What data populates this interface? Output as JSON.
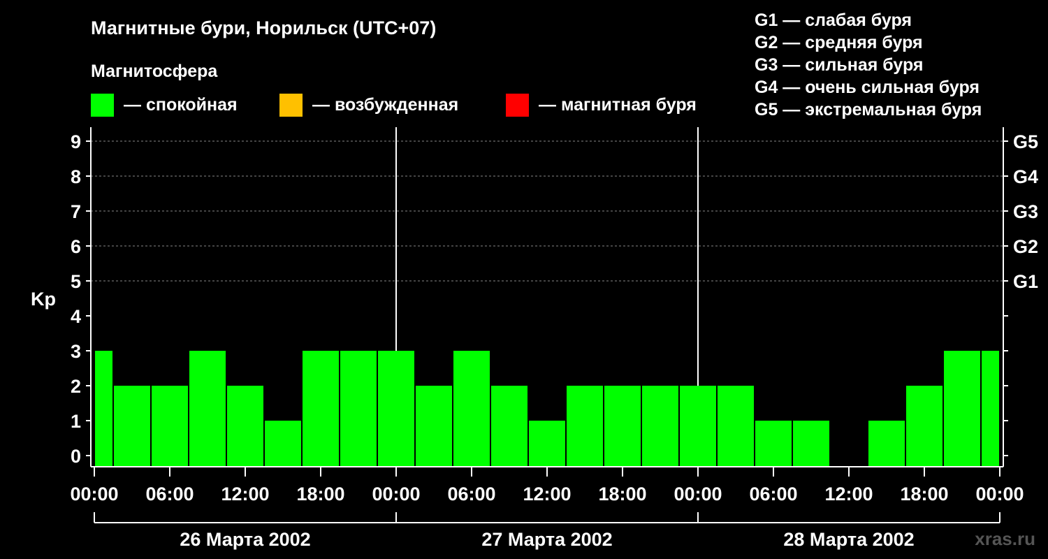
{
  "chart_data": {
    "type": "bar",
    "title": "Магнитные бури, Норильск (UTC+07)",
    "legend_title": "Магнитосфера",
    "legend": [
      {
        "label": "— спокойная",
        "color": "#00ff00"
      },
      {
        "label": "— возбужденная",
        "color": "#ffc000"
      },
      {
        "label": "— магнитная буря",
        "color": "#ff0000"
      }
    ],
    "g_scale_legend": [
      "G1 — слабая буря",
      "G2 — средняя буря",
      "G3 — сильная буря",
      "G4 — очень сильная буря",
      "G5 — экстремальная буря"
    ],
    "ylabel": "Kp",
    "ylim": [
      0,
      9
    ],
    "yticks": [
      "0",
      "1",
      "2",
      "3",
      "4",
      "5",
      "6",
      "7",
      "8",
      "9"
    ],
    "right_ticks": [
      {
        "kp": 5,
        "label": "G1"
      },
      {
        "kp": 6,
        "label": "G2"
      },
      {
        "kp": 7,
        "label": "G3"
      },
      {
        "kp": 8,
        "label": "G4"
      },
      {
        "kp": 9,
        "label": "G5"
      }
    ],
    "x_ticks": [
      "00:00",
      "06:00",
      "12:00",
      "18:00",
      "00:00",
      "06:00",
      "12:00",
      "18:00",
      "00:00",
      "06:00",
      "12:00",
      "18:00",
      "00:00"
    ],
    "days": [
      "26 Марта 2002",
      "27 Марта 2002",
      "28 Марта 2002"
    ],
    "bar_interval_hours": 3,
    "values": [
      3,
      2,
      2,
      3,
      2,
      1,
      3,
      3,
      3,
      2,
      3,
      2,
      1,
      2,
      2,
      2,
      2,
      2,
      1,
      1,
      0,
      1,
      2,
      3,
      3
    ],
    "bar_color": "#00ff00",
    "grid": "dashed horizontal",
    "watermark": "xras.ru"
  }
}
